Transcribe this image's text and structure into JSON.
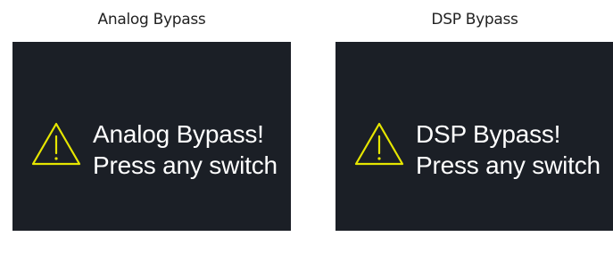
{
  "panels": [
    {
      "caption": "Analog Bypass",
      "message_line1": "Analog Bypass!",
      "message_line2": "Press any switch"
    },
    {
      "caption": "DSP Bypass",
      "message_line1": "DSP Bypass!",
      "message_line2": "Press any switch"
    }
  ],
  "icons": {
    "warning": "warning-triangle-icon"
  },
  "colors": {
    "screen_background": "#1b1f26",
    "warning_icon": "#e6e600",
    "message_text": "#ffffff",
    "caption_text": "#222222"
  }
}
